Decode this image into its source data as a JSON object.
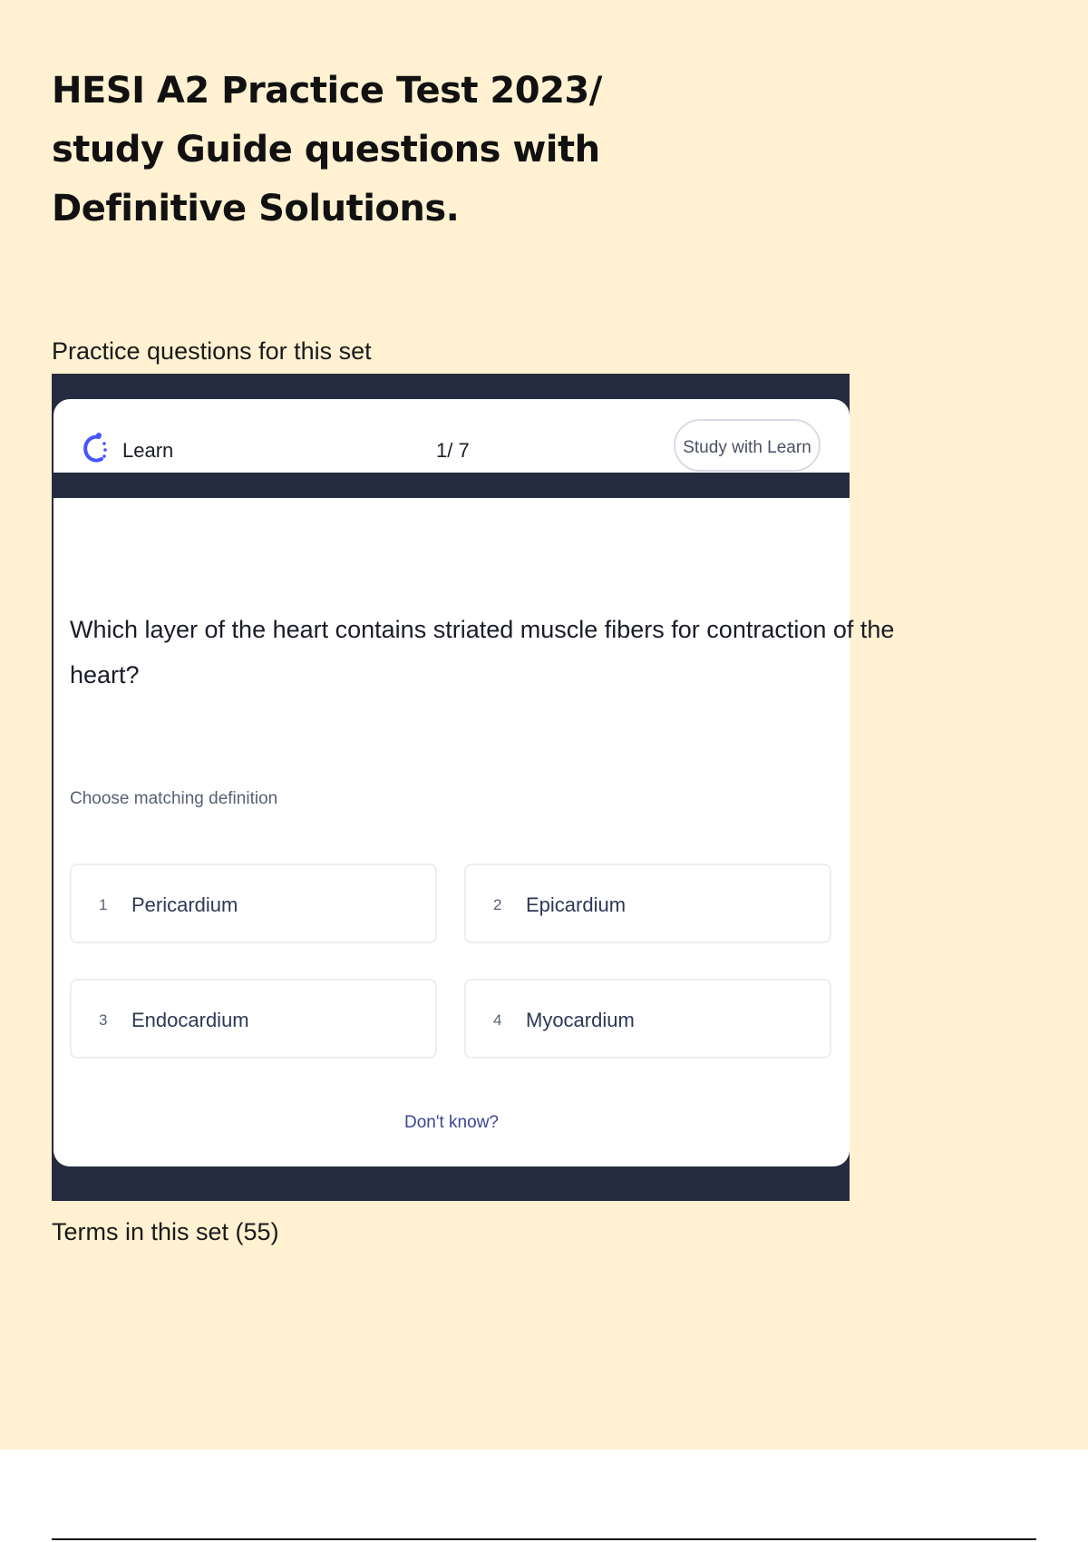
{
  "document": {
    "title_lines": [
      "HESI A2 Practice Test 2023/",
      "study Guide questions with",
      "Definitive Solutions."
    ],
    "practice_heading": "Practice questions for this set",
    "terms_heading": "Terms in this set (55)"
  },
  "learn_widget": {
    "mode_label": "Learn",
    "mode_icon": "learn-ring-icon",
    "progress": "1/ 7",
    "study_button_label": "Study with Learn",
    "question": "Which layer of the heart contains striated muscle fibers for contraction of the heart?",
    "prompt": "Choose matching definition",
    "options": [
      {
        "number": "1",
        "label": "Pericardium"
      },
      {
        "number": "2",
        "label": "Epicardium"
      },
      {
        "number": "3",
        "label": "Endocardium"
      },
      {
        "number": "4",
        "label": "Myocardium"
      }
    ],
    "dont_know_label": "Don't know?",
    "colors": {
      "frame": "#262c3f",
      "accent": "#4255ff",
      "link": "#3c4693"
    }
  },
  "colors": {
    "page_background": "#fff1d1"
  }
}
